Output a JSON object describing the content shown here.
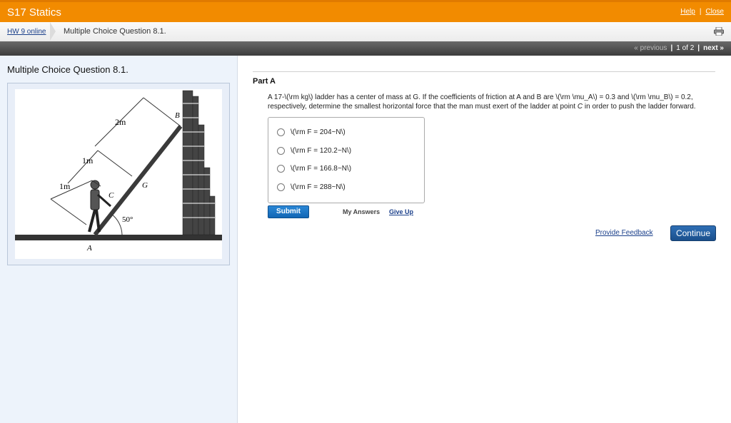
{
  "app": {
    "title": "S17 Statics",
    "help": "Help",
    "close": "Close",
    "sep": "|"
  },
  "breadcrumb": {
    "link": "HW 9 online",
    "current": "Multiple Choice Question 8.1."
  },
  "pager": {
    "prev": "« previous",
    "position": "1 of 2",
    "next": "next »",
    "sep": "|"
  },
  "left": {
    "title": "Multiple Choice Question 8.1.",
    "figure": {
      "labels": {
        "dim_2m": "2m",
        "dim_1m_upper": "1m",
        "dim_1m_lower": "1m",
        "point_b": "B",
        "point_c": "C",
        "point_g": "G",
        "point_a": "A",
        "angle": "50°"
      }
    }
  },
  "part": {
    "title": "Part A",
    "question_line1": "A 17-\\(\\rm kg\\) ladder has a center of mass at G. If the coefficients of friction at A and B are \\(\\rm \\mu_A\\) = 0.3 and \\(\\rm \\mu_B\\) = 0.2,",
    "question_line2_pre": "respectively, determine the smallest horizontal force that the man must exert of the ladder at point ",
    "question_line2_c": "C",
    "question_line2_post": " in order to push the ladder forward.",
    "choices": [
      "\\(\\rm F = 204~N\\)",
      "\\(\\rm F = 120.2~N\\)",
      "\\(\\rm F = 166.8~N\\)",
      "\\(\\rm F = 288~N\\)"
    ],
    "submit": "Submit",
    "my_answers": "My Answers",
    "give_up": "Give Up"
  },
  "footer": {
    "feedback": "Provide Feedback",
    "continue": "Continue"
  }
}
